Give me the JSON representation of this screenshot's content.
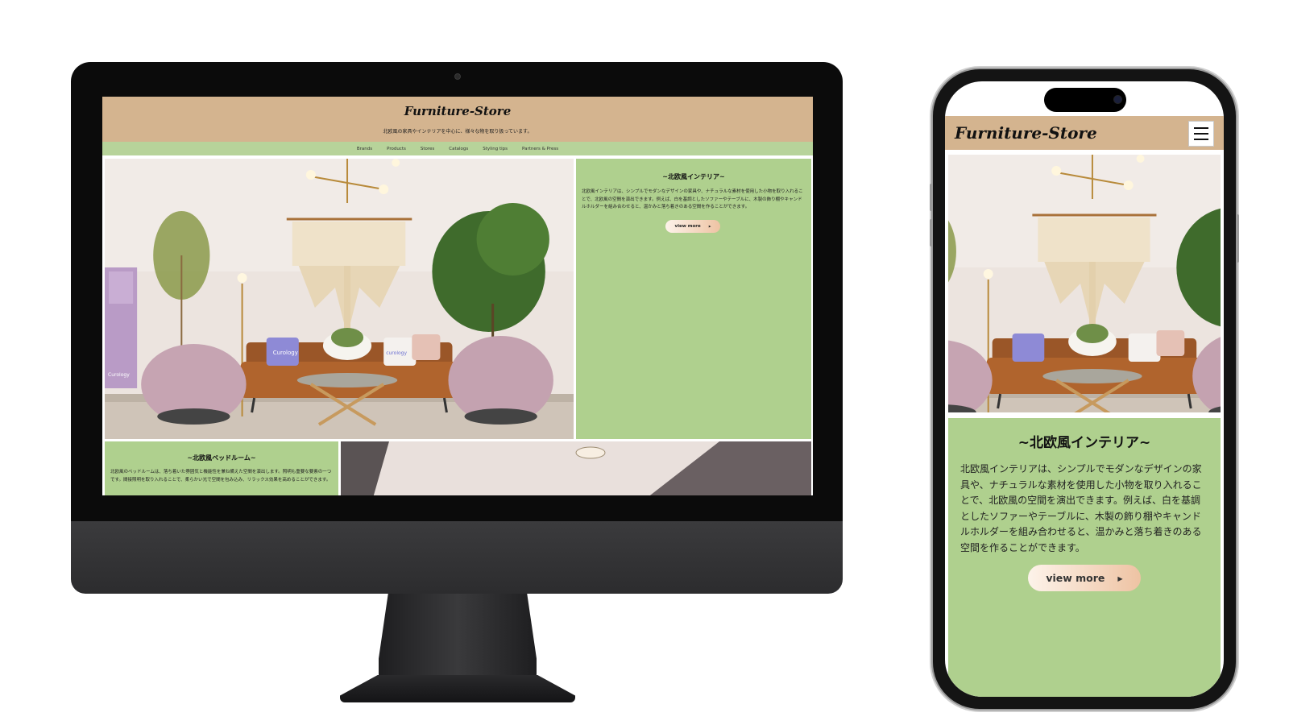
{
  "site": {
    "logo": "Furniture-Store",
    "tagline": "北欧風の家具やインテリアを中心に、様々な物を取り扱っています。"
  },
  "nav": [
    "Brands",
    "Products",
    "Stores",
    "Catalogs",
    "Styling tips",
    "Partners & Press"
  ],
  "feature": {
    "title": "~北欧風インテリア~",
    "body": "北欧風インテリアは、シンプルでモダンなデザインの家具や、ナチュラルな素材を使用した小物を取り入れることで、北欧風の空間を演出できます。例えば、白を基調としたソファーやテーブルに、木製の飾り棚やキャンドルホルダーを組み合わせると、温かみと落ち着きのある空間を作ることができます。",
    "button_label": "view more",
    "button_icon": "caret-right-icon"
  },
  "bedroom": {
    "title": "~北欧風ベッドルーム~",
    "body": "北欧風のベッドルームは、落ち着いた雰囲気と機能性を兼ね備えた空間を演出します。照明も重要な要素の一つです。間接照明を取り入れることで、柔らかい光で空間を包み込み、リラックス効果を高めることができます。"
  },
  "photo_text": {
    "pillow_left": "Curology",
    "pillow_right": "curology",
    "towel": "Curology"
  },
  "icons": {
    "menu": "hamburger-menu-icon",
    "camera": "camera-icon"
  },
  "colors": {
    "header": "#d4b48f",
    "nav": "#b7d39a",
    "card": "#afd08e",
    "button_start": "#fdf3ea",
    "button_end": "#eec3a3"
  }
}
